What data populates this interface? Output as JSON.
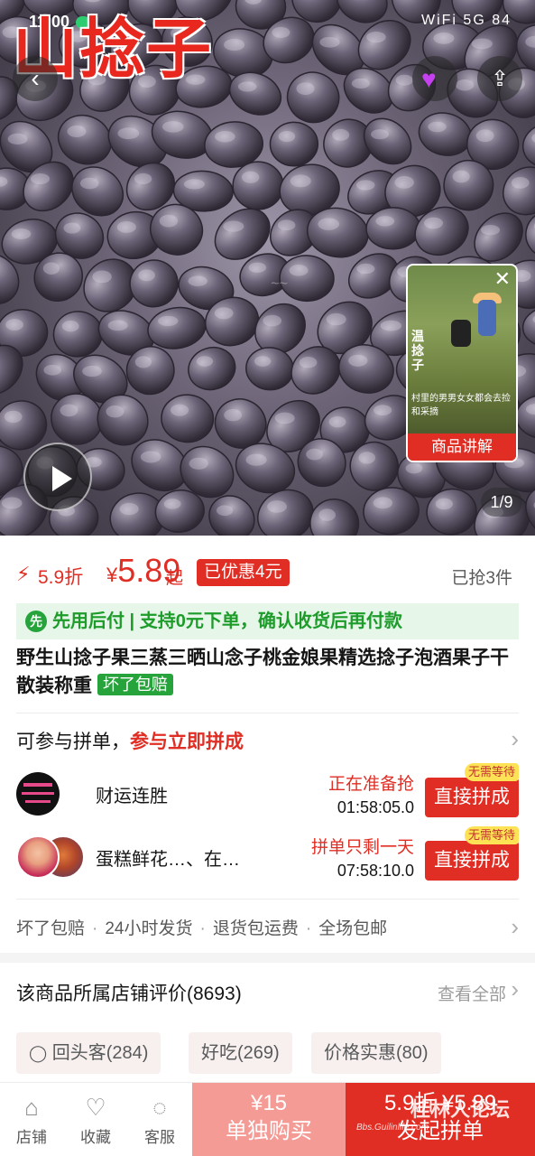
{
  "status_bar": {
    "time": "11:00",
    "right": "WiFi 5G 84"
  },
  "hero": {
    "overlay_title": "山捻子",
    "page_indicator": "1/9",
    "video_card": {
      "label": "商品讲解",
      "side_text": "温捻子",
      "caption": "村里的男男女女都会去捡和采摘"
    }
  },
  "price": {
    "discount": "5.9折",
    "currency": "¥",
    "amount": "5.89",
    "suffix": "起",
    "coupon": "已优惠4元",
    "sold": "已抢3件"
  },
  "pay_later": {
    "badge": "先",
    "text": "先用后付 | 支持0元下单，确认收货后再付款"
  },
  "product": {
    "title": "野生山捻子果三蒸三晒山念子桃金娘果精选捻子泡酒果子干散装称重",
    "tag": "坏了包赔"
  },
  "group_buy": {
    "heading_prefix": "可参与拼单，",
    "heading_highlight": "参与立即拼成",
    "rows": [
      {
        "name": "财运连胜",
        "state": "正在准备抢",
        "countdown": "01:58:05.0",
        "button": "直接拼成",
        "badge": "无需等待"
      },
      {
        "name": "蛋糕鲜花…、在…",
        "state": "拼单只剩一天",
        "countdown": "07:58:10.0",
        "button": "直接拼成",
        "badge": "无需等待"
      }
    ]
  },
  "services": [
    "坏了包赔",
    "24小时发货",
    "退货包运费",
    "全场包邮"
  ],
  "reviews": {
    "title": "该商品所属店铺评价(8693)",
    "view_all": "查看全部",
    "chips": [
      "回头客(284)",
      "好吃(269)",
      "价格实惠(80)"
    ]
  },
  "bottom_bar": {
    "tabs": [
      {
        "label": "店铺",
        "icon": "store-icon"
      },
      {
        "label": "收藏",
        "icon": "heart-icon"
      },
      {
        "label": "客服",
        "icon": "chat-icon"
      }
    ],
    "single_price": "¥15",
    "single_label": "单独购买",
    "group_price": "5.9折 ¥5.89",
    "group_label": "发起拼单",
    "watermark": "桂林人论坛",
    "watermark_url": "Bbs.Guilinlife.com"
  },
  "colors": {
    "accent": "#e02e24",
    "green": "#26a33a"
  }
}
